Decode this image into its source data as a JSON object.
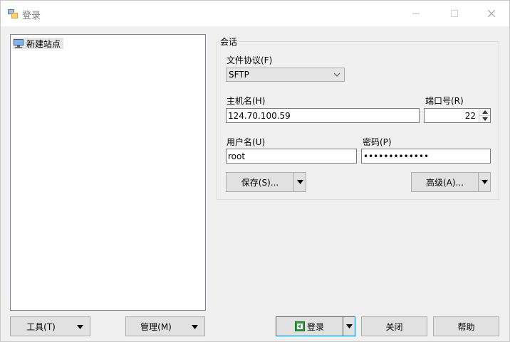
{
  "window": {
    "title": "登录"
  },
  "sites": {
    "items": [
      {
        "label": "新建站点"
      }
    ]
  },
  "session": {
    "legend": "会话",
    "protocol_label": "文件协议(F)",
    "protocol_value": "SFTP",
    "host_label": "主机名(H)",
    "host_value": "124.70.100.59",
    "port_label": "端口号(R)",
    "port_value": "22",
    "user_label": "用户名(U)",
    "user_value": "root",
    "password_label": "密码(P)",
    "password_mask": "•••••••••••••",
    "save_label": "保存(S)...",
    "advanced_label": "高级(A)..."
  },
  "footer": {
    "tools_label": "工具(T)",
    "manage_label": "管理(M)",
    "login_label": "登录",
    "close_label": "关闭",
    "help_label": "帮助"
  },
  "colors": {
    "accent": "#0078d7",
    "button_bg": "#e1e1e1",
    "window_bg": "#f0f0f0"
  },
  "icons": {
    "app": "winscp-icon",
    "site": "computer-icon",
    "login": "login-icon"
  }
}
